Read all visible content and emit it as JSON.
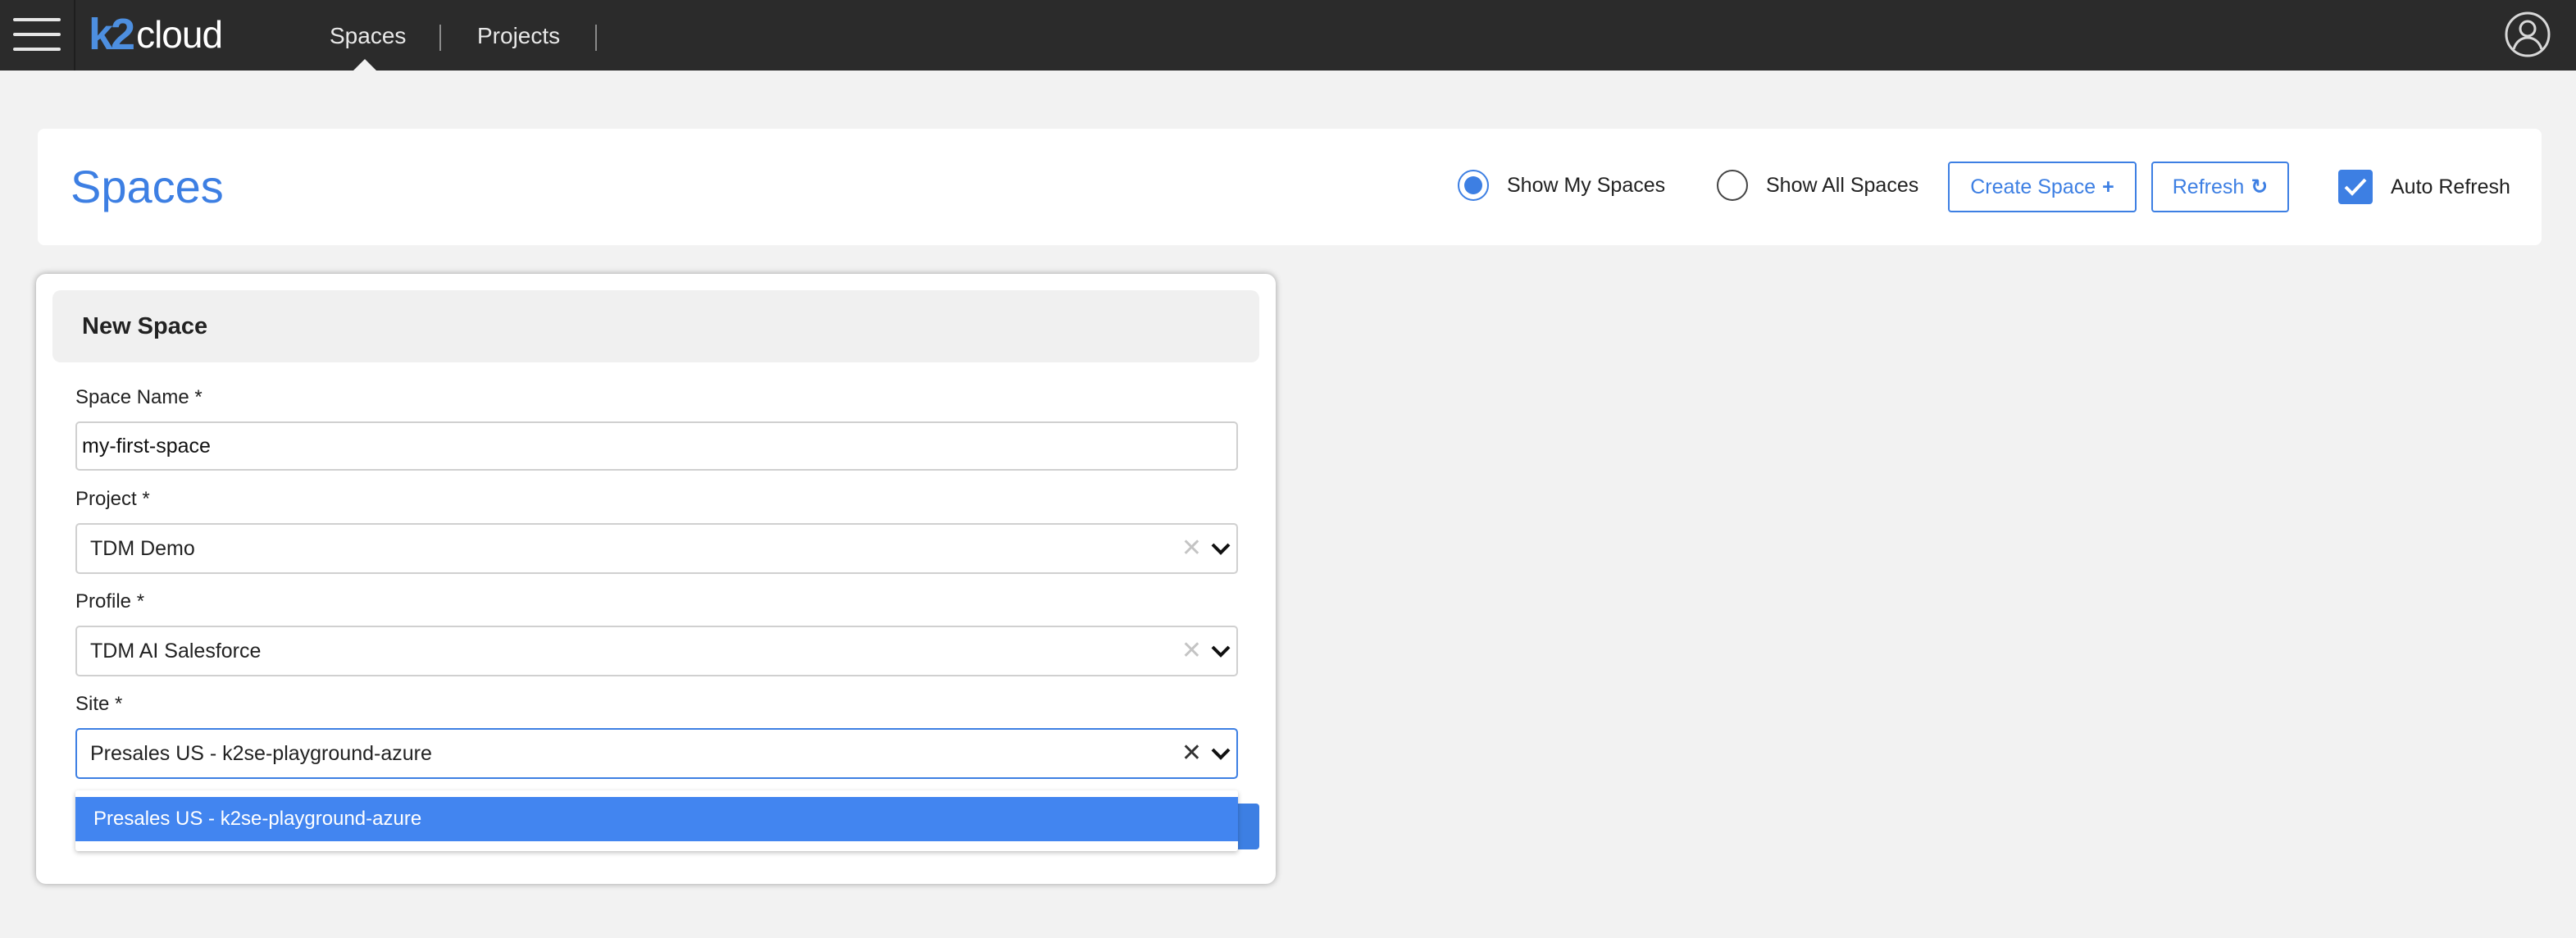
{
  "app": {
    "logo_k2": "k2",
    "logo_cloud": "cloud"
  },
  "nav": {
    "items": [
      {
        "label": "Spaces",
        "active": true
      },
      {
        "label": "Projects",
        "active": false
      }
    ]
  },
  "header": {
    "title": "Spaces",
    "show_my_spaces": {
      "label": "Show My Spaces",
      "checked": true
    },
    "show_all_spaces": {
      "label": "Show All Spaces",
      "checked": false
    },
    "create_space_label": "Create Space",
    "create_space_icon": "+",
    "refresh_label": "Refresh",
    "refresh_icon": "↻",
    "auto_refresh": {
      "label": "Auto Refresh",
      "checked": true
    }
  },
  "dialog": {
    "title": "New Space",
    "space_name": {
      "label": "Space Name *",
      "value": "my-first-space"
    },
    "project": {
      "label": "Project *",
      "value": "TDM Demo"
    },
    "profile": {
      "label": "Profile *",
      "value": "TDM AI Salesforce"
    },
    "site": {
      "label": "Site *",
      "value": "Presales US - k2se-playground-azure",
      "options": [
        "Presales US - k2se-playground-azure"
      ]
    },
    "clear_glyph": "✕"
  },
  "colors": {
    "accent": "#3d7fe3",
    "topbar": "#2b2b2b",
    "dropdown_highlight": "#4285f0"
  },
  "icons": [
    "menu-icon",
    "user-icon",
    "checkmark-icon",
    "chevron-down-icon",
    "clear-icon"
  ]
}
